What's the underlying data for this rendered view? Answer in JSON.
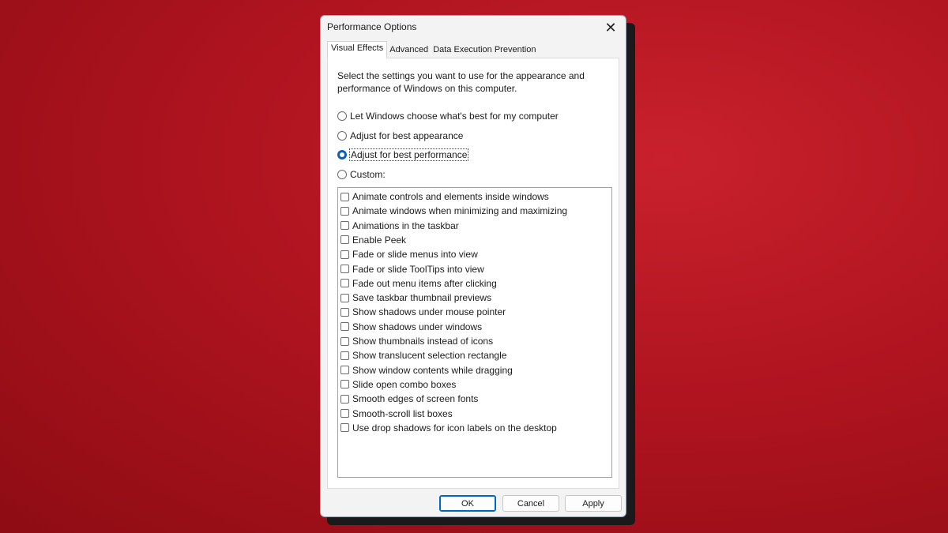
{
  "dialog": {
    "title": "Performance Options",
    "close_glyph": "✕"
  },
  "tabs": [
    {
      "label": "Visual Effects",
      "active": true
    },
    {
      "label": "Advanced",
      "active": false
    },
    {
      "label": "Data Execution Prevention",
      "active": false
    }
  ],
  "visual_effects": {
    "description": "Select the settings you want to use for the appearance and performance of Windows on this computer.",
    "options": [
      {
        "label": "Let Windows choose what's best for my computer",
        "checked": false
      },
      {
        "label": "Adjust for best appearance",
        "checked": false
      },
      {
        "label": "Adjust for best performance",
        "checked": true
      },
      {
        "label": "Custom:",
        "checked": false
      }
    ],
    "effects": [
      {
        "label": "Animate controls and elements inside windows",
        "checked": false
      },
      {
        "label": "Animate windows when minimizing and maximizing",
        "checked": false
      },
      {
        "label": "Animations in the taskbar",
        "checked": false
      },
      {
        "label": "Enable Peek",
        "checked": false
      },
      {
        "label": "Fade or slide menus into view",
        "checked": false
      },
      {
        "label": "Fade or slide ToolTips into view",
        "checked": false
      },
      {
        "label": "Fade out menu items after clicking",
        "checked": false
      },
      {
        "label": "Save taskbar thumbnail previews",
        "checked": false
      },
      {
        "label": "Show shadows under mouse pointer",
        "checked": false
      },
      {
        "label": "Show shadows under windows",
        "checked": false
      },
      {
        "label": "Show thumbnails instead of icons",
        "checked": false
      },
      {
        "label": "Show translucent selection rectangle",
        "checked": false
      },
      {
        "label": "Show window contents while dragging",
        "checked": false
      },
      {
        "label": "Slide open combo boxes",
        "checked": false
      },
      {
        "label": "Smooth edges of screen fonts",
        "checked": false
      },
      {
        "label": "Smooth-scroll list boxes",
        "checked": false
      },
      {
        "label": "Use drop shadows for icon labels on the desktop",
        "checked": false
      }
    ]
  },
  "buttons": {
    "ok": "OK",
    "cancel": "Cancel",
    "apply": "Apply"
  },
  "colors": {
    "background": "#b0141f",
    "accent": "#0b5fc4"
  }
}
